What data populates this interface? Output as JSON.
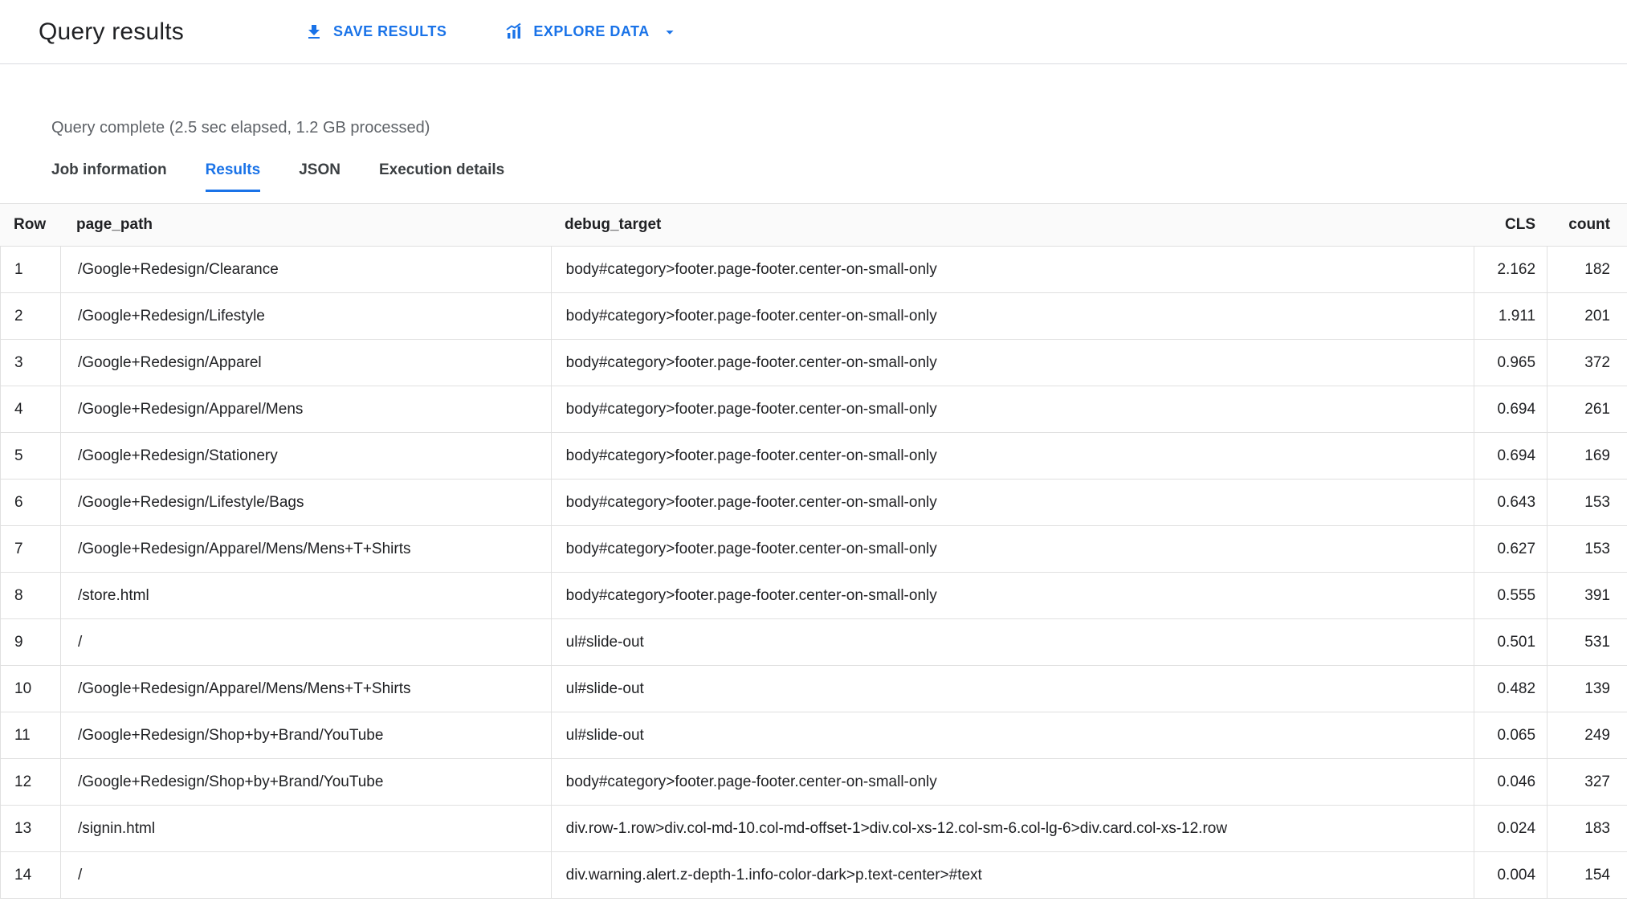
{
  "header": {
    "title": "Query results",
    "save_results_label": "SAVE RESULTS",
    "explore_data_label": "EXPLORE DATA"
  },
  "status": "Query complete (2.5 sec elapsed, 1.2 GB processed)",
  "tabs": [
    {
      "label": "Job information",
      "active": false
    },
    {
      "label": "Results",
      "active": true
    },
    {
      "label": "JSON",
      "active": false
    },
    {
      "label": "Execution details",
      "active": false
    }
  ],
  "table": {
    "columns": [
      "Row",
      "page_path",
      "debug_target",
      "CLS",
      "count"
    ],
    "rows": [
      {
        "row": "1",
        "page_path": "/Google+Redesign/Clearance",
        "debug_target": "body#category>footer.page-footer.center-on-small-only",
        "cls": "2.162",
        "count": "182"
      },
      {
        "row": "2",
        "page_path": "/Google+Redesign/Lifestyle",
        "debug_target": "body#category>footer.page-footer.center-on-small-only",
        "cls": "1.911",
        "count": "201"
      },
      {
        "row": "3",
        "page_path": "/Google+Redesign/Apparel",
        "debug_target": "body#category>footer.page-footer.center-on-small-only",
        "cls": "0.965",
        "count": "372"
      },
      {
        "row": "4",
        "page_path": "/Google+Redesign/Apparel/Mens",
        "debug_target": "body#category>footer.page-footer.center-on-small-only",
        "cls": "0.694",
        "count": "261"
      },
      {
        "row": "5",
        "page_path": "/Google+Redesign/Stationery",
        "debug_target": "body#category>footer.page-footer.center-on-small-only",
        "cls": "0.694",
        "count": "169"
      },
      {
        "row": "6",
        "page_path": "/Google+Redesign/Lifestyle/Bags",
        "debug_target": "body#category>footer.page-footer.center-on-small-only",
        "cls": "0.643",
        "count": "153"
      },
      {
        "row": "7",
        "page_path": "/Google+Redesign/Apparel/Mens/Mens+T+Shirts",
        "debug_target": "body#category>footer.page-footer.center-on-small-only",
        "cls": "0.627",
        "count": "153"
      },
      {
        "row": "8",
        "page_path": "/store.html",
        "debug_target": "body#category>footer.page-footer.center-on-small-only",
        "cls": "0.555",
        "count": "391"
      },
      {
        "row": "9",
        "page_path": "/",
        "debug_target": "ul#slide-out",
        "cls": "0.501",
        "count": "531"
      },
      {
        "row": "10",
        "page_path": "/Google+Redesign/Apparel/Mens/Mens+T+Shirts",
        "debug_target": "ul#slide-out",
        "cls": "0.482",
        "count": "139"
      },
      {
        "row": "11",
        "page_path": "/Google+Redesign/Shop+by+Brand/YouTube",
        "debug_target": "ul#slide-out",
        "cls": "0.065",
        "count": "249"
      },
      {
        "row": "12",
        "page_path": "/Google+Redesign/Shop+by+Brand/YouTube",
        "debug_target": "body#category>footer.page-footer.center-on-small-only",
        "cls": "0.046",
        "count": "327"
      },
      {
        "row": "13",
        "page_path": "/signin.html",
        "debug_target": "div.row-1.row>div.col-md-10.col-md-offset-1>div.col-xs-12.col-sm-6.col-lg-6>div.card.col-xs-12.row",
        "cls": "0.024",
        "count": "183"
      },
      {
        "row": "14",
        "page_path": "/",
        "debug_target": "div.warning.alert.z-depth-1.info-color-dark>p.text-center>#text",
        "cls": "0.004",
        "count": "154"
      }
    ]
  },
  "colors": {
    "accent": "#1a73e8",
    "border": "#e0e0e0",
    "text_primary": "#202124",
    "text_secondary": "#5f6368",
    "header_row_bg": "#fafafa"
  }
}
